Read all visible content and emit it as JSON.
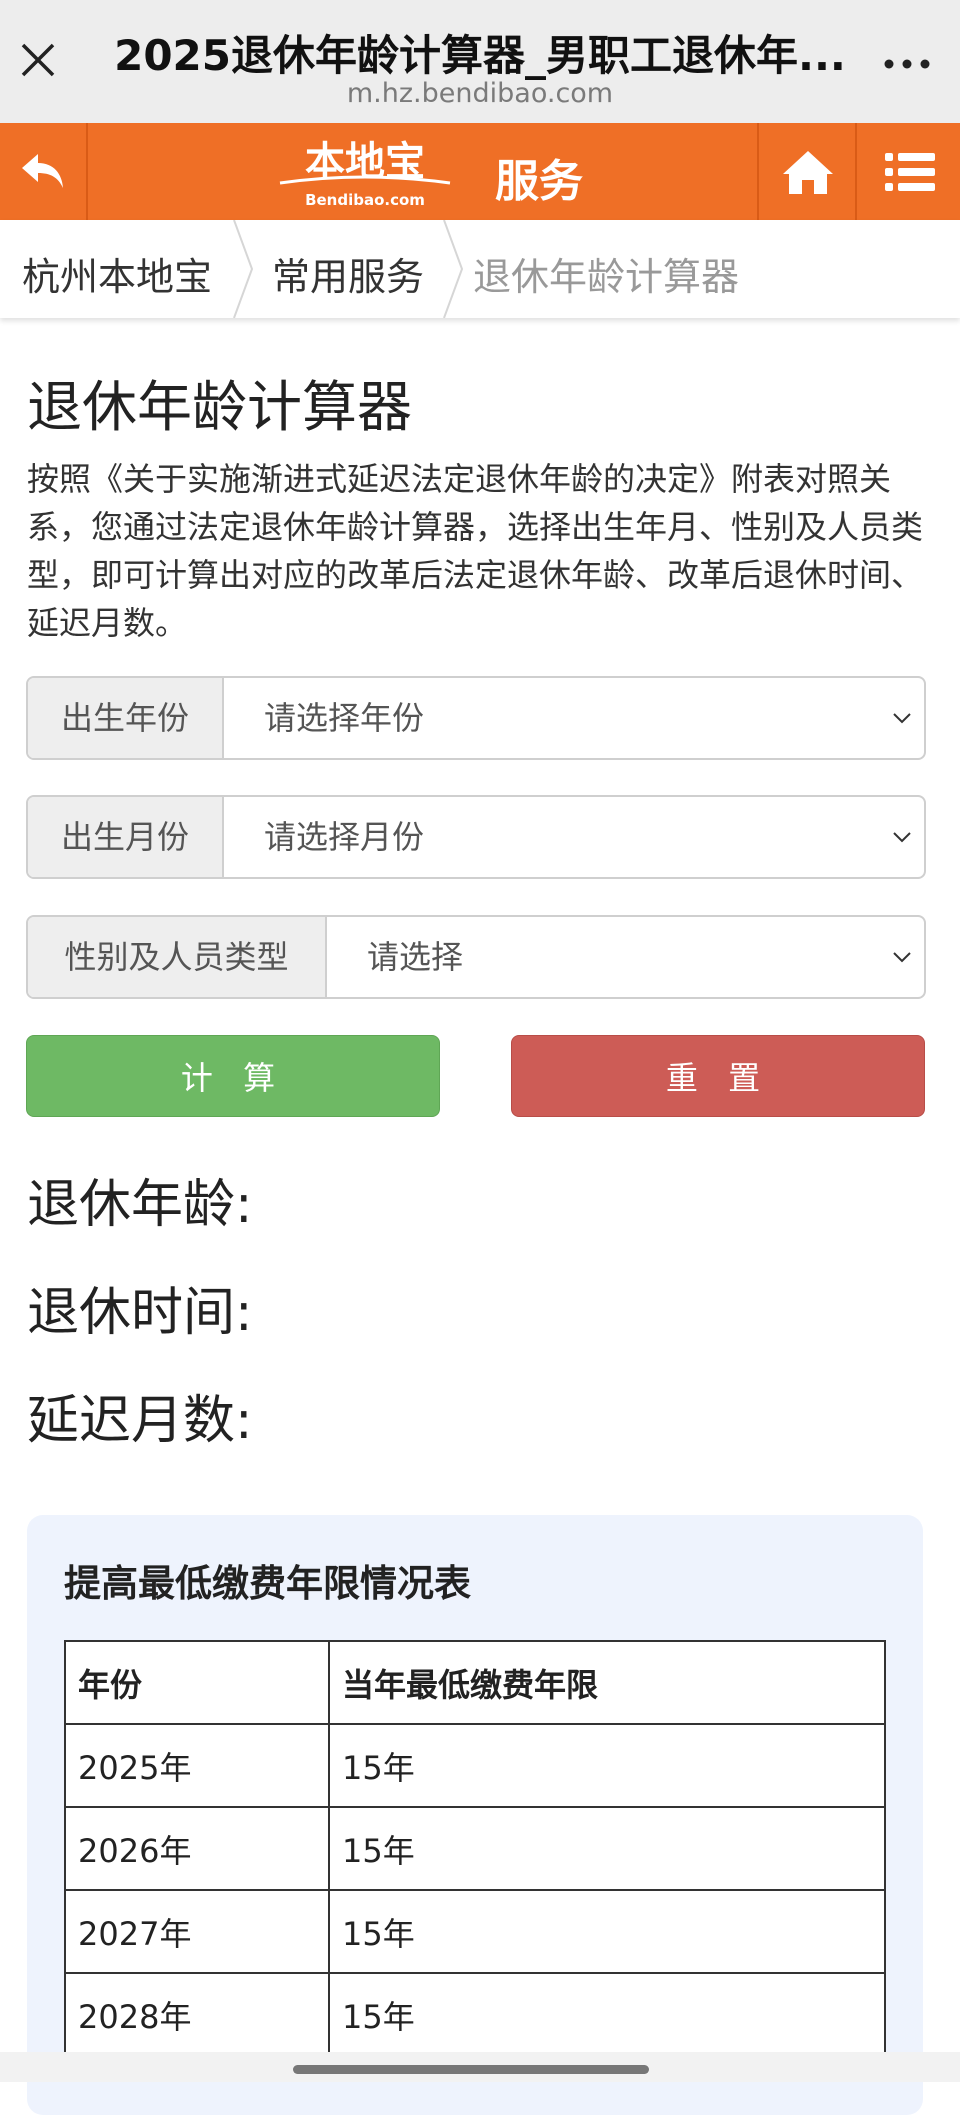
{
  "browser": {
    "title": "2025退休年龄计算器_男职工退休年...",
    "url": "m.hz.bendibao.com"
  },
  "header": {
    "logo_text": "本地宝",
    "logo_sub": "Bendibao.com",
    "service_label": "服务",
    "brand_color": "#ef6f26"
  },
  "breadcrumb": [
    "杭州本地宝",
    "常用服务",
    "退休年龄计算器"
  ],
  "main": {
    "title": "退休年龄计算器",
    "intro": "按照《关于实施渐进式延迟法定退休年龄的决定》附表对照关系，您通过法定退休年龄计算器，选择出生年月、性别及人员类型，即可计算出对应的改革后法定退休年龄、改革后退休时间、延迟月数。"
  },
  "form": {
    "birth_year": {
      "label": "出生年份",
      "value": "请选择年份"
    },
    "birth_month": {
      "label": "出生月份",
      "value": "请选择月份"
    },
    "person_type": {
      "label": "性别及人员类型",
      "value": "请选择"
    },
    "calc_label": "计 算",
    "reset_label": "重 置"
  },
  "results": {
    "age_label": "退休年龄:",
    "time_label": "退休时间:",
    "delay_label": "延迟月数:"
  },
  "table": {
    "title": "提高最低缴费年限情况表",
    "headers": [
      "年份",
      "当年最低缴费年限"
    ],
    "rows": [
      [
        "2025年",
        "15年"
      ],
      [
        "2026年",
        "15年"
      ],
      [
        "2027年",
        "15年"
      ],
      [
        "2028年",
        "15年"
      ]
    ]
  }
}
